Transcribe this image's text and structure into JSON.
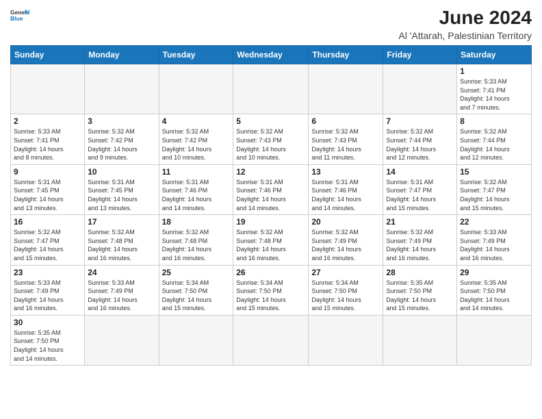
{
  "header": {
    "logo_general": "General",
    "logo_blue": "Blue",
    "month_year": "June 2024",
    "location": "Al 'Attarah, Palestinian Territory"
  },
  "days_of_week": [
    "Sunday",
    "Monday",
    "Tuesday",
    "Wednesday",
    "Thursday",
    "Friday",
    "Saturday"
  ],
  "weeks": [
    [
      {
        "day": "",
        "info": ""
      },
      {
        "day": "",
        "info": ""
      },
      {
        "day": "",
        "info": ""
      },
      {
        "day": "",
        "info": ""
      },
      {
        "day": "",
        "info": ""
      },
      {
        "day": "",
        "info": ""
      },
      {
        "day": "1",
        "info": "Sunrise: 5:33 AM\nSunset: 7:41 PM\nDaylight: 14 hours\nand 7 minutes."
      }
    ],
    [
      {
        "day": "2",
        "info": "Sunrise: 5:33 AM\nSunset: 7:41 PM\nDaylight: 14 hours\nand 8 minutes."
      },
      {
        "day": "3",
        "info": "Sunrise: 5:32 AM\nSunset: 7:42 PM\nDaylight: 14 hours\nand 9 minutes."
      },
      {
        "day": "4",
        "info": "Sunrise: 5:32 AM\nSunset: 7:42 PM\nDaylight: 14 hours\nand 10 minutes."
      },
      {
        "day": "5",
        "info": "Sunrise: 5:32 AM\nSunset: 7:43 PM\nDaylight: 14 hours\nand 10 minutes."
      },
      {
        "day": "6",
        "info": "Sunrise: 5:32 AM\nSunset: 7:43 PM\nDaylight: 14 hours\nand 11 minutes."
      },
      {
        "day": "7",
        "info": "Sunrise: 5:32 AM\nSunset: 7:44 PM\nDaylight: 14 hours\nand 12 minutes."
      },
      {
        "day": "8",
        "info": "Sunrise: 5:32 AM\nSunset: 7:44 PM\nDaylight: 14 hours\nand 12 minutes."
      }
    ],
    [
      {
        "day": "9",
        "info": "Sunrise: 5:31 AM\nSunset: 7:45 PM\nDaylight: 14 hours\nand 13 minutes."
      },
      {
        "day": "10",
        "info": "Sunrise: 5:31 AM\nSunset: 7:45 PM\nDaylight: 14 hours\nand 13 minutes."
      },
      {
        "day": "11",
        "info": "Sunrise: 5:31 AM\nSunset: 7:46 PM\nDaylight: 14 hours\nand 14 minutes."
      },
      {
        "day": "12",
        "info": "Sunrise: 5:31 AM\nSunset: 7:46 PM\nDaylight: 14 hours\nand 14 minutes."
      },
      {
        "day": "13",
        "info": "Sunrise: 5:31 AM\nSunset: 7:46 PM\nDaylight: 14 hours\nand 14 minutes."
      },
      {
        "day": "14",
        "info": "Sunrise: 5:31 AM\nSunset: 7:47 PM\nDaylight: 14 hours\nand 15 minutes."
      },
      {
        "day": "15",
        "info": "Sunrise: 5:32 AM\nSunset: 7:47 PM\nDaylight: 14 hours\nand 15 minutes."
      }
    ],
    [
      {
        "day": "16",
        "info": "Sunrise: 5:32 AM\nSunset: 7:47 PM\nDaylight: 14 hours\nand 15 minutes."
      },
      {
        "day": "17",
        "info": "Sunrise: 5:32 AM\nSunset: 7:48 PM\nDaylight: 14 hours\nand 16 minutes."
      },
      {
        "day": "18",
        "info": "Sunrise: 5:32 AM\nSunset: 7:48 PM\nDaylight: 14 hours\nand 16 minutes."
      },
      {
        "day": "19",
        "info": "Sunrise: 5:32 AM\nSunset: 7:48 PM\nDaylight: 14 hours\nand 16 minutes."
      },
      {
        "day": "20",
        "info": "Sunrise: 5:32 AM\nSunset: 7:49 PM\nDaylight: 14 hours\nand 16 minutes."
      },
      {
        "day": "21",
        "info": "Sunrise: 5:32 AM\nSunset: 7:49 PM\nDaylight: 14 hours\nand 16 minutes."
      },
      {
        "day": "22",
        "info": "Sunrise: 5:33 AM\nSunset: 7:49 PM\nDaylight: 14 hours\nand 16 minutes."
      }
    ],
    [
      {
        "day": "23",
        "info": "Sunrise: 5:33 AM\nSunset: 7:49 PM\nDaylight: 14 hours\nand 16 minutes."
      },
      {
        "day": "24",
        "info": "Sunrise: 5:33 AM\nSunset: 7:49 PM\nDaylight: 14 hours\nand 16 minutes."
      },
      {
        "day": "25",
        "info": "Sunrise: 5:34 AM\nSunset: 7:50 PM\nDaylight: 14 hours\nand 15 minutes."
      },
      {
        "day": "26",
        "info": "Sunrise: 5:34 AM\nSunset: 7:50 PM\nDaylight: 14 hours\nand 15 minutes."
      },
      {
        "day": "27",
        "info": "Sunrise: 5:34 AM\nSunset: 7:50 PM\nDaylight: 14 hours\nand 15 minutes."
      },
      {
        "day": "28",
        "info": "Sunrise: 5:35 AM\nSunset: 7:50 PM\nDaylight: 14 hours\nand 15 minutes."
      },
      {
        "day": "29",
        "info": "Sunrise: 5:35 AM\nSunset: 7:50 PM\nDaylight: 14 hours\nand 14 minutes."
      }
    ],
    [
      {
        "day": "30",
        "info": "Sunrise: 5:35 AM\nSunset: 7:50 PM\nDaylight: 14 hours\nand 14 minutes."
      },
      {
        "day": "",
        "info": ""
      },
      {
        "day": "",
        "info": ""
      },
      {
        "day": "",
        "info": ""
      },
      {
        "day": "",
        "info": ""
      },
      {
        "day": "",
        "info": ""
      },
      {
        "day": "",
        "info": ""
      }
    ]
  ]
}
